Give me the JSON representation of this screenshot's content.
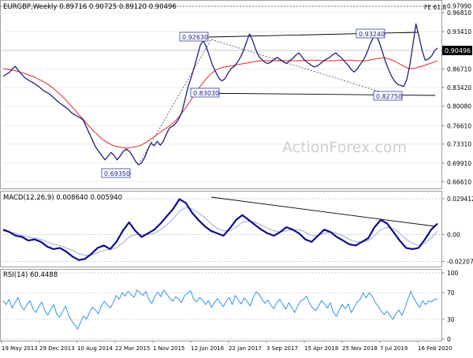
{
  "chart_data": [
    {
      "type": "line",
      "panel": "price",
      "title": "EURGBP,Weekly",
      "ohlc_header": "0.89716 0.90725 0.89120 0.90496",
      "fib_label": "FE 61.8",
      "watermark": "ActionForex.com",
      "current_price": "0.90496",
      "y_ticks": [
        "0.97990",
        "0.96810",
        "0.93410",
        "0.90090",
        "0.86710",
        "0.83420",
        "0.80080",
        "0.76610",
        "0.73310",
        "0.69910",
        "0.66610"
      ],
      "ylim": [
        0.658,
        0.985
      ],
      "annotations": [
        "0.92630",
        "0.93240",
        "0.83030",
        "0.82750",
        "0.69350"
      ],
      "series": [
        {
          "values": [
            0.854,
            0.858,
            0.861,
            0.868,
            0.872,
            0.864,
            0.858,
            0.852,
            0.848,
            0.845,
            0.842,
            0.838,
            0.834,
            0.829,
            0.826,
            0.823,
            0.818,
            0.813,
            0.808,
            0.804,
            0.8,
            0.796,
            0.79,
            0.786,
            0.783,
            0.78,
            0.776,
            0.764,
            0.752,
            0.74,
            0.728,
            0.72,
            0.713,
            0.705,
            0.711,
            0.718,
            0.713,
            0.705,
            0.712,
            0.72,
            0.724,
            0.72,
            0.712,
            0.702,
            0.696,
            0.7,
            0.71,
            0.724,
            0.735,
            0.73,
            0.738,
            0.731,
            0.738,
            0.751,
            0.762,
            0.765,
            0.77,
            0.778,
            0.79,
            0.812,
            0.835,
            0.852,
            0.87,
            0.89,
            0.91,
            0.918,
            0.906,
            0.89,
            0.874,
            0.862,
            0.851,
            0.846,
            0.85,
            0.86,
            0.868,
            0.872,
            0.879,
            0.888,
            0.9,
            0.916,
            0.93,
            0.918,
            0.902,
            0.89,
            0.884,
            0.879,
            0.877,
            0.88,
            0.885,
            0.888,
            0.884,
            0.88,
            0.877,
            0.882,
            0.886,
            0.892,
            0.896,
            0.889,
            0.882,
            0.878,
            0.874,
            0.871,
            0.873,
            0.877,
            0.882,
            0.885,
            0.888,
            0.893,
            0.896,
            0.891,
            0.886,
            0.88,
            0.874,
            0.866,
            0.862,
            0.868,
            0.876,
            0.884,
            0.895,
            0.91,
            0.922,
            0.93,
            0.916,
            0.9,
            0.882,
            0.868,
            0.855,
            0.846,
            0.84,
            0.838,
            0.836,
            0.848,
            0.874,
            0.91,
            0.948,
            0.925,
            0.9,
            0.883,
            0.885,
            0.89,
            0.9,
            0.905
          ]
        },
        {
          "values": [
            0.868,
            0.867,
            0.866,
            0.865,
            0.864,
            0.863,
            0.861,
            0.859,
            0.857,
            0.855,
            0.853,
            0.85,
            0.847,
            0.844,
            0.841,
            0.837,
            0.833,
            0.828,
            0.823,
            0.818,
            0.812,
            0.806,
            0.8,
            0.794,
            0.787,
            0.781,
            0.775,
            0.768,
            0.762,
            0.756,
            0.751,
            0.745,
            0.741,
            0.737,
            0.734,
            0.731,
            0.729,
            0.728,
            0.727,
            0.726,
            0.726,
            0.727,
            0.728,
            0.729,
            0.731,
            0.734,
            0.737,
            0.741,
            0.745,
            0.749,
            0.753,
            0.757,
            0.761,
            0.765,
            0.769,
            0.774,
            0.78,
            0.787,
            0.795,
            0.803,
            0.811,
            0.82,
            0.828,
            0.836,
            0.843,
            0.85,
            0.856,
            0.861,
            0.865,
            0.868,
            0.87,
            0.871,
            0.872,
            0.873,
            0.874,
            0.875,
            0.876,
            0.877,
            0.878,
            0.879,
            0.88,
            0.881,
            0.882,
            0.882,
            0.882,
            0.882,
            0.882,
            0.882,
            0.882,
            0.882,
            0.882,
            0.882,
            0.882,
            0.882,
            0.882,
            0.882,
            0.883,
            0.883,
            0.883,
            0.883,
            0.883,
            0.883,
            0.882,
            0.882,
            0.882,
            0.882,
            0.882,
            0.883,
            0.883,
            0.883,
            0.883,
            0.883,
            0.883,
            0.882,
            0.882,
            0.882,
            0.882,
            0.883,
            0.884,
            0.885,
            0.886,
            0.887,
            0.887,
            0.886,
            0.884,
            0.882,
            0.879,
            0.876,
            0.873,
            0.87,
            0.868,
            0.868,
            0.869,
            0.871,
            0.872,
            0.874,
            0.876,
            0.878,
            0.88,
            0.882
          ]
        }
      ],
      "color_price": "#1a237e",
      "color_ma": "#e53935",
      "color_bg": "#ffffff",
      "color_grid": "#e3e3e3"
    },
    {
      "type": "line",
      "panel": "macd",
      "title": "MACD(12,26,9) 0.008640 0.005940",
      "y_ticks": [
        "0.029412",
        "0.00",
        "-0.022074"
      ],
      "ylim": [
        -0.025,
        0.032
      ],
      "series": [
        {
          "values": [
            0.004,
            0.002,
            -0.001,
            -0.002,
            -0.005,
            -0.004,
            -0.006,
            -0.01,
            -0.012,
            -0.011,
            -0.014,
            -0.018,
            -0.021,
            -0.02,
            -0.016,
            -0.011,
            -0.009,
            -0.012,
            -0.006,
            0.003,
            0.01,
            0.003,
            -0.002,
            0.001,
            0.004,
            0.009,
            0.015,
            0.021,
            0.029,
            0.026,
            0.018,
            0.012,
            0.007,
            0.003,
            0.001,
            -0.001,
            0.005,
            0.012,
            0.016,
            0.012,
            0.008,
            0.004,
            0.001,
            -0.001,
            0.002,
            0.006,
            0.004,
            0.001,
            -0.004,
            -0.006,
            -0.001,
            0.004,
            0.002,
            -0.002,
            -0.005,
            -0.008,
            -0.009,
            -0.006,
            -0.003,
            0.006,
            0.012,
            0.009,
            0.002,
            -0.005,
            -0.011,
            -0.012,
            -0.011,
            -0.004,
            0.004,
            0.009
          ]
        },
        {
          "values": [
            0.003,
            0.002,
            0.001,
            -0.001,
            -0.002,
            -0.003,
            -0.004,
            -0.006,
            -0.008,
            -0.009,
            -0.011,
            -0.013,
            -0.016,
            -0.017,
            -0.017,
            -0.015,
            -0.013,
            -0.012,
            -0.011,
            -0.007,
            -0.002,
            0.0,
            0.0,
            0.0,
            0.001,
            0.004,
            0.008,
            0.013,
            0.019,
            0.022,
            0.021,
            0.018,
            0.014,
            0.009,
            0.005,
            0.003,
            0.003,
            0.006,
            0.01,
            0.011,
            0.01,
            0.008,
            0.005,
            0.003,
            0.002,
            0.003,
            0.004,
            0.004,
            0.002,
            -0.001,
            -0.001,
            0.001,
            0.002,
            0.001,
            -0.001,
            -0.004,
            -0.006,
            -0.006,
            -0.005,
            -0.001,
            0.004,
            0.006,
            0.005,
            0.001,
            -0.004,
            -0.007,
            -0.009,
            -0.007,
            -0.003,
            0.003
          ]
        }
      ],
      "color_macd": "#0d0d8c",
      "color_signal": "#9fa8da",
      "color_trend": "#000000"
    },
    {
      "type": "line",
      "panel": "rsi",
      "title": "RSI(14) 60.4488",
      "y_ticks": [
        "100",
        "70",
        "30",
        "0"
      ],
      "ylim": [
        0,
        100
      ],
      "series": [
        {
          "values": [
            58,
            52,
            60,
            47,
            55,
            63,
            50,
            44,
            52,
            58,
            46,
            40,
            49,
            56,
            43,
            36,
            45,
            52,
            38,
            33,
            42,
            50,
            36,
            28,
            22,
            15,
            25,
            35,
            30,
            40,
            48,
            44,
            38,
            50,
            57,
            52,
            47,
            55,
            66,
            60,
            70,
            65,
            72,
            67,
            63,
            74,
            70,
            66,
            72,
            60,
            54,
            65,
            71,
            64,
            74,
            68,
            62,
            57,
            64,
            60,
            55,
            66,
            69,
            73,
            61,
            56,
            63,
            59,
            52,
            58,
            48,
            55,
            61,
            55,
            49,
            57,
            63,
            52,
            66,
            59,
            53,
            62,
            57,
            50,
            62,
            71,
            68,
            60,
            54,
            59,
            51,
            46,
            55,
            60,
            52,
            45,
            55,
            48,
            40,
            50,
            58,
            60,
            65,
            54,
            47,
            43,
            50,
            58,
            53,
            47,
            55,
            40,
            34,
            45,
            52,
            46,
            53,
            40,
            48,
            56,
            60,
            70,
            62,
            70,
            65,
            56,
            50,
            43,
            37,
            42,
            36,
            30,
            38,
            44,
            36,
            46,
            60,
            72,
            62,
            54,
            48,
            58,
            52,
            58,
            56,
            60,
            60
          ]
        }
      ],
      "color_rsi": "#1e88e5"
    }
  ],
  "x_labels": [
    "19 May 2013",
    "29 Dec 2013",
    "10 Aug 2014",
    "22 Mar 2015",
    "1 Nov 2015",
    "12 Jun 2016",
    "22 Jan 2017",
    "3 Sep 2017",
    "15 Apr 2018",
    "25 Nov 2018",
    "7 Jul 2019",
    "16 Feb 2020"
  ]
}
